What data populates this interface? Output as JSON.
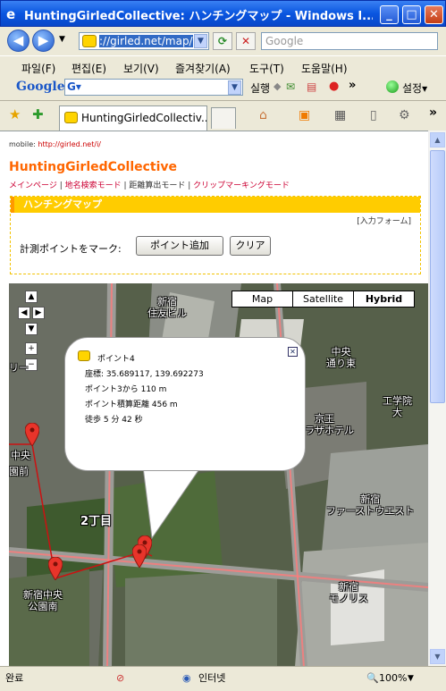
{
  "window": {
    "title": "HuntingGirledCollective: ハンチングマップ - Windows I..."
  },
  "toolbar": {
    "address": "://girled.net/map/",
    "search_placeholder": "Google"
  },
  "menu": [
    "파일(F)",
    "편집(E)",
    "보기(V)",
    "즐겨찾기(A)",
    "도구(T)",
    "도움말(H)"
  ],
  "googlebar": {
    "logo": "Google",
    "run": "실행",
    "settings": "설정"
  },
  "tab": {
    "label": "HuntingGirledCollectiv..."
  },
  "page": {
    "mobile_label": "mobile:",
    "mobile_url": "http://girled.net/i/",
    "site_title": "HuntingGirledCollective",
    "links": [
      "メインページ",
      "地名検索モード",
      "距離算出モード",
      "クリップマーキングモード"
    ],
    "panel_title": "ハンチングマップ",
    "input_form": "[入力フォーム]",
    "mark_label": "計測ポイントをマーク:",
    "add_point": "ポイント追加",
    "clear": "クリア"
  },
  "map": {
    "types": [
      "Map",
      "Satellite",
      "Hybrid"
    ],
    "selected_type": "Hybrid",
    "labels": [
      "新宿\n住友ビル",
      "中央\n通り東",
      "京王\nプラザホテル",
      "工学院\n大",
      "新宿\nファーストウエスト",
      "新宿\nモノリス",
      "新宿中央\n公園南",
      "2丁目",
      "中央",
      "園前",
      "リー"
    ],
    "info": {
      "title": "ポイント4",
      "coords": "座標: 35.689117, 139.692273",
      "from_prev": "ポイント3から 110 m",
      "total": "ポイント積算距離 456 m",
      "walk": "徒歩 5 分 42 秒"
    }
  },
  "status": {
    "left": "완료",
    "zone": "인터넷",
    "zoom": "100%"
  }
}
